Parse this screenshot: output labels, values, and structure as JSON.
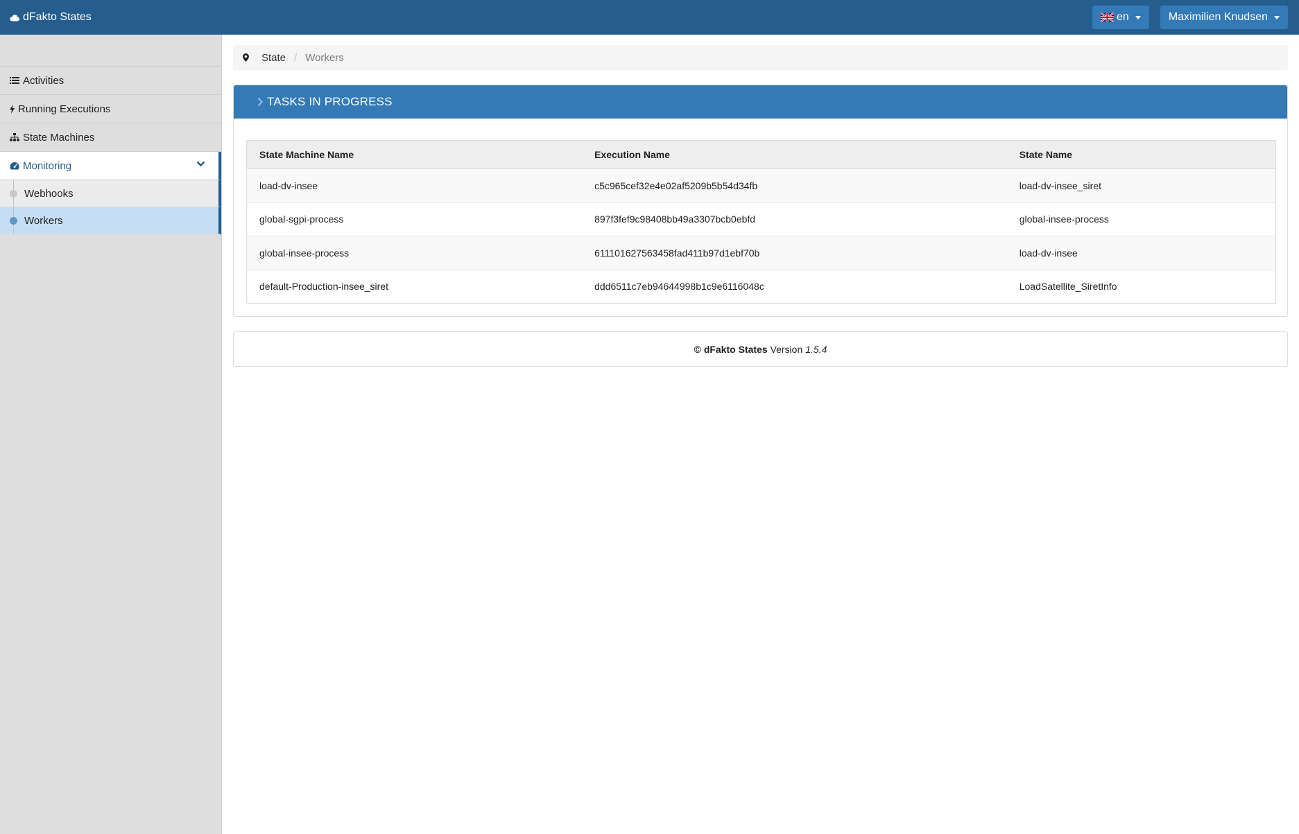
{
  "app": {
    "brand": "dFakto States"
  },
  "header": {
    "language": "en",
    "user": "Maximilien Knudsen"
  },
  "sidebar": {
    "items": [
      {
        "label": "Activities",
        "icon": "list-icon"
      },
      {
        "label": "Running Executions",
        "icon": "bolt-icon"
      },
      {
        "label": "State Machines",
        "icon": "sitemap-icon"
      },
      {
        "label": "Monitoring",
        "icon": "dashboard-icon",
        "active": true
      }
    ],
    "submenu": [
      {
        "label": "Webhooks"
      },
      {
        "label": "Workers",
        "selected": true
      }
    ]
  },
  "breadcrumb": {
    "root": "State",
    "separator": "/",
    "current": "Workers"
  },
  "panel": {
    "title": "TASKS IN PROGRESS",
    "columns": [
      "State Machine Name",
      "Execution Name",
      "State Name"
    ],
    "rows": [
      [
        "load-dv-insee",
        "c5c965cef32e4e02af5209b5b54d34fb",
        "load-dv-insee_siret"
      ],
      [
        "global-sgpi-process",
        "897f3fef9c98408bb49a3307bcb0ebfd",
        "global-insee-process"
      ],
      [
        "global-insee-process",
        "611101627563458fad411b97d1ebf70b",
        "load-dv-insee"
      ],
      [
        "default-Production-insee_siret",
        "ddd6511c7eb94644998b1c9e6116048c",
        "LoadSatellite_SiretInfo"
      ]
    ]
  },
  "footer": {
    "copyright": "©",
    "brand": "dFakto States",
    "version_label": "Version",
    "version": "1.5.4"
  },
  "colors": {
    "navbar": "#255d8f",
    "primary": "#337ab7",
    "sidebar": "#dedede",
    "selected": "#c6def4"
  }
}
